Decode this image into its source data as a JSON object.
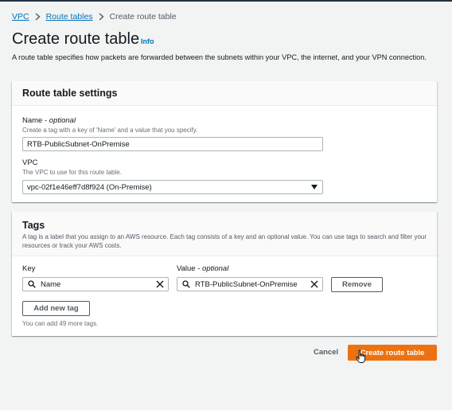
{
  "breadcrumb": {
    "items": [
      "VPC",
      "Route tables"
    ],
    "current": "Create route table"
  },
  "header": {
    "title": "Create route table",
    "info": "Info",
    "description": "A route table specifies how packets are forwarded between the subnets within your VPC, the internet, and your VPN connection."
  },
  "settings": {
    "title": "Route table settings",
    "name_label": "Name",
    "name_optional": "optional",
    "name_desc": "Create a tag with a key of 'Name' and a value that you specify.",
    "name_value": "RTB-PublicSubnet-OnPremise",
    "vpc_label": "VPC",
    "vpc_desc": "The VPC to use for this route table.",
    "vpc_value": "vpc-02f1e46eff7d8f924 (On-Premise)"
  },
  "tags": {
    "title": "Tags",
    "description": "A tag is a label that you assign to an AWS resource. Each tag consists of a key and an optional value. You can use tags to search and filter your resources or track your AWS costs.",
    "key_label": "Key",
    "value_label": "Value",
    "value_optional": "optional",
    "rows": [
      {
        "key": "Name",
        "value": "RTB-PublicSubnet-OnPremise"
      }
    ],
    "remove_label": "Remove",
    "add_label": "Add new tag",
    "limit_text": "You can add 49 more tags."
  },
  "footer": {
    "cancel_label": "Cancel",
    "create_label": "Create route table"
  },
  "colors": {
    "primary": "#ec7211",
    "link": "#0073bb",
    "background": "#f2f3f3"
  },
  "icons": [
    "chevron-right-icon",
    "search-icon",
    "clear-icon",
    "caret-down-icon",
    "cursor-icon"
  ]
}
